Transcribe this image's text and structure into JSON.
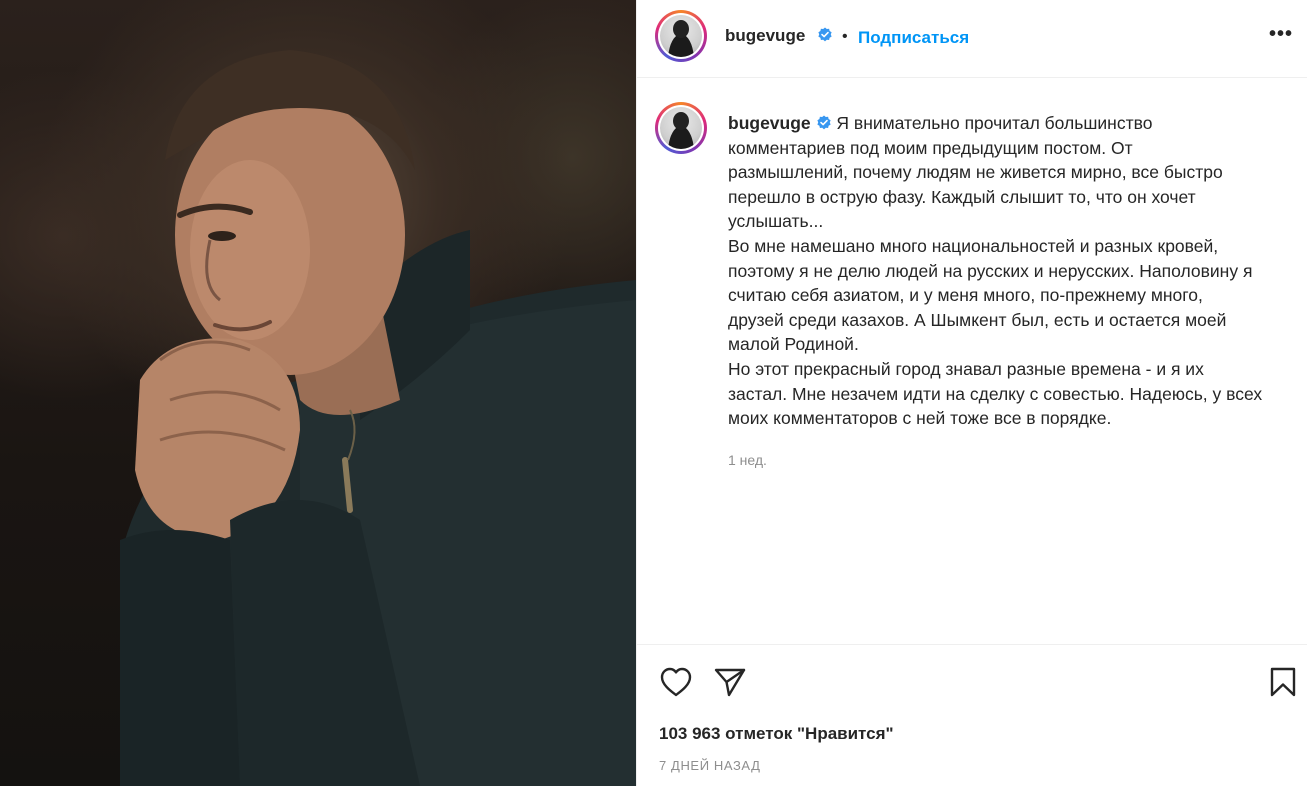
{
  "post": {
    "username": "bugevuge",
    "verified": true,
    "dot": "•",
    "follow_label": "Подписаться",
    "more_label": "•••"
  },
  "caption": {
    "username": "bugevuge",
    "lines": [
      "Я внимательно прочитал большинство",
      "комментариев под моим предыдущим постом. От",
      "размышлений, почему людям не живется мирно, все быстро",
      "перешло в острую фазу. Каждый слышит то, что он хочет",
      "услышать...",
      "Во мне намешано много национальностей и разных кровей,",
      "поэтому я не делю людей на русских и нерусских. Наполовину я",
      "считаю себя азиатом, и у меня много, по-прежнему много,",
      "друзей среди казахов. А Шымкент был, есть и остается моей",
      "малой Родиной.",
      "Но этот прекрасный город знавал разные времена - и я их",
      "застал. Мне незачем идти на сделку с совестью. Надеюсь, у всех",
      "моих комментаторов с ней тоже все в порядке."
    ],
    "time": "1 нед."
  },
  "actions": {
    "like_icon": "heart-icon",
    "share_icon": "paper-plane-icon",
    "save_icon": "bookmark-icon",
    "likes_text": "103 963 отметок \"Нравится\"",
    "date_text": "7 ДНЕЙ НАЗАД"
  },
  "colors": {
    "accent": "#0095f6",
    "text": "#262626",
    "muted": "#8e8e8e",
    "verified": "#3897f0"
  }
}
